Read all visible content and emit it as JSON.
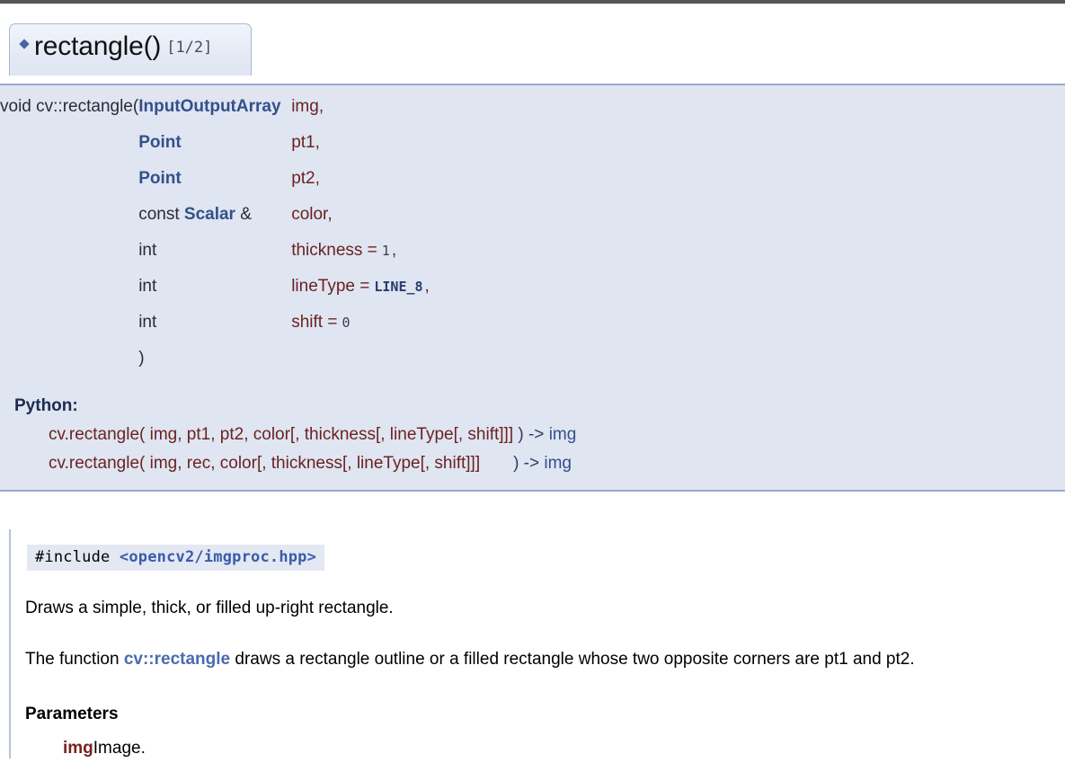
{
  "page": {
    "top_rule_color": "#555555",
    "accent_blue": "#33508b",
    "param_red": "#6b2222",
    "proto_bg": "#dfe5f1"
  },
  "member": {
    "bullet_icon": "diamond-bullet-icon",
    "title": "rectangle()",
    "overload_index": "[1/2]"
  },
  "prototype": {
    "return_type": "void",
    "qualified_name": "cv::rectangle",
    "open_paren": "(",
    "close_paren": ")",
    "parameters": [
      {
        "type_link": "InputOutputArray",
        "type_prefix": "",
        "type_suffix": "",
        "name": "img",
        "separator": ",",
        "default": "",
        "default_mono": false
      },
      {
        "type_link": "Point",
        "type_prefix": "",
        "type_suffix": "",
        "name": "pt1",
        "separator": ",",
        "default": "",
        "default_mono": false
      },
      {
        "type_link": "Point",
        "type_prefix": "",
        "type_suffix": "",
        "name": "pt2",
        "separator": ",",
        "default": "",
        "default_mono": false
      },
      {
        "type_link": "Scalar",
        "type_prefix": "const ",
        "type_suffix": " &",
        "name": "color",
        "separator": ",",
        "default": "",
        "default_mono": false
      },
      {
        "type_link": "",
        "type_prefix": "int",
        "type_suffix": "",
        "name": "thickness",
        "separator": ",",
        "default": "1",
        "default_mono": true
      },
      {
        "type_link": "",
        "type_prefix": "int",
        "type_suffix": "",
        "name": "lineType",
        "separator": ",",
        "default": "LINE_8",
        "default_mono": true,
        "default_is_keyword": true
      },
      {
        "type_link": "",
        "type_prefix": "int",
        "type_suffix": "",
        "name": "shift",
        "separator": "",
        "default": "0",
        "default_mono": true
      }
    ]
  },
  "python": {
    "label": "Python:",
    "signatures": [
      {
        "call": "cv.rectangle( img, pt1, pt2, color[, thickness[, lineType[, shift]]] ",
        "close": ")",
        "arrow": " -> ",
        "returns": "img"
      },
      {
        "call": "cv.rectangle( img, rec, color[, thickness[, lineType[, shift]]]       ",
        "close": ")",
        "arrow": " -> ",
        "returns": "img"
      }
    ]
  },
  "documentation": {
    "include_directive": "#include ",
    "include_path": "<opencv2/imgproc.hpp>",
    "brief": "Draws a simple, thick, or filled up-right rectangle.",
    "detail_prefix": "The function ",
    "detail_link": "cv::rectangle",
    "detail_suffix": " draws a rectangle outline or a filled rectangle whose two opposite corners are pt1 and pt2.",
    "parameters_heading": "Parameters",
    "parameters": [
      {
        "name": "img",
        "description": "Image."
      }
    ]
  }
}
